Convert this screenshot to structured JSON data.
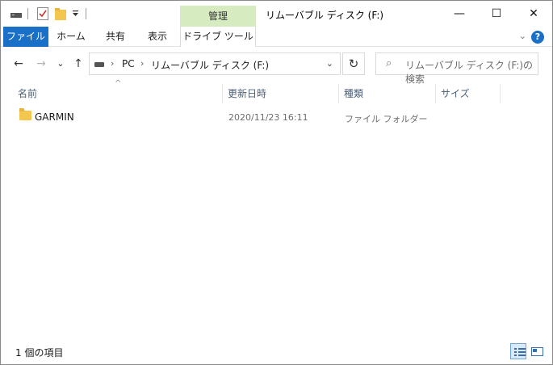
{
  "titlebar": {
    "manage_tab": "管理",
    "title": "リムーバブル ディスク (F:)",
    "minimize_glyph": "—",
    "maximize_glyph": "☐",
    "close_glyph": "✕"
  },
  "ribbon": {
    "tabs": [
      "ファイル",
      "ホーム",
      "共有",
      "表示",
      "ドライブ ツール"
    ],
    "help_glyph": "?",
    "collapse_glyph": "⌄"
  },
  "nav": {
    "back_glyph": "←",
    "forward_glyph": "→",
    "recent_glyph": "⌄",
    "up_glyph": "↑",
    "breadcrumb": [
      "PC",
      "リムーバブル ディスク (F:)"
    ],
    "breadcrumb_sep": "›",
    "dropdown_glyph": "⌄",
    "refresh_glyph": "↻",
    "search_placeholder": "リムーバブル ディスク (F:)の検索",
    "search_glyph": "⌕"
  },
  "list": {
    "columns": [
      "名前",
      "更新日時",
      "種類",
      "サイズ"
    ],
    "sort_glyph": "^",
    "rows": [
      {
        "name": "GARMIN",
        "modified": "2020/11/23 16:11",
        "type": "ファイル フォルダー",
        "size": ""
      }
    ]
  },
  "status": {
    "item_count": "1 個の項目"
  },
  "colors": {
    "accent": "#1a6fc6",
    "manage_tab": "#d7ebc1",
    "folder": "#f3c74e"
  }
}
